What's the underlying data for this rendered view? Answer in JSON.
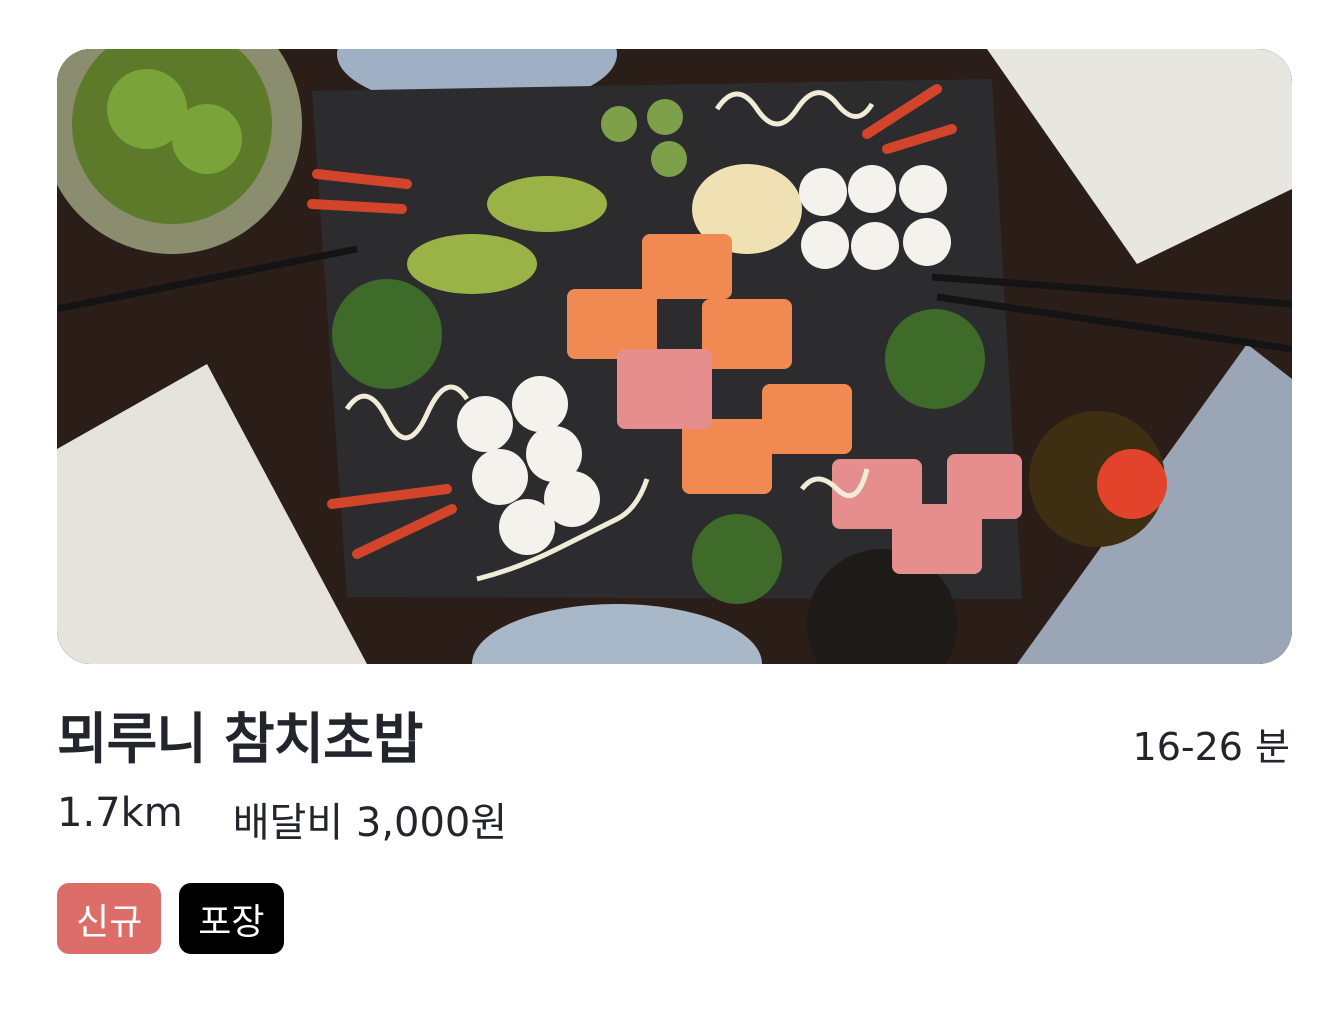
{
  "restaurant": {
    "name": "뫼루니 참치초밥",
    "eta": "16-26 분",
    "distance": "1.7km",
    "delivery_fee": "배달비 3,000원",
    "image_alt": "sushi-platter-photo"
  },
  "badges": [
    {
      "label": "신규",
      "color": "#dd6d69"
    },
    {
      "label": "포장",
      "color": "#000000"
    }
  ]
}
